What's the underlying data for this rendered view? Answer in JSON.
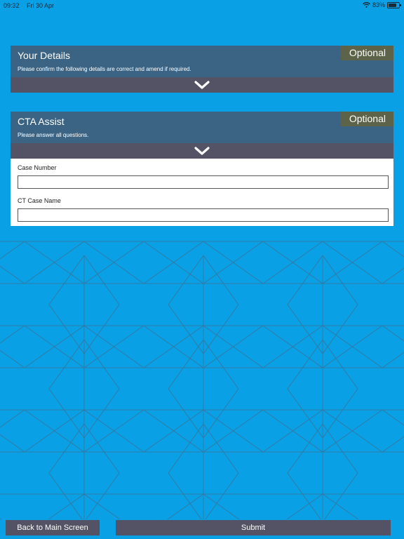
{
  "status_bar": {
    "time": "09:32",
    "date": "Fri 30 Apr",
    "battery": "83%",
    "icons": [
      "wifi-icon",
      "battery-icon"
    ]
  },
  "your_details": {
    "title": "Your Details",
    "subtitle": "Please confirm the following details are correct and amend if required.",
    "badge": "Optional",
    "expanded": false
  },
  "cta_assist": {
    "title": "CTA Assist",
    "subtitle": "Please answer all questions.",
    "badge": "Optional",
    "expanded": true,
    "fields": [
      {
        "label": "Case Number",
        "value": "",
        "placeholder": ""
      },
      {
        "label": "CT Case Name",
        "value": "",
        "placeholder": ""
      }
    ]
  },
  "footer": {
    "back_label": "Back to Main Screen",
    "submit_label": "Submit"
  },
  "colors": {
    "background": "#0aa0e6",
    "panel_header": "#3b6484",
    "toggle_bar": "#535365",
    "badge": "#5c6348"
  }
}
